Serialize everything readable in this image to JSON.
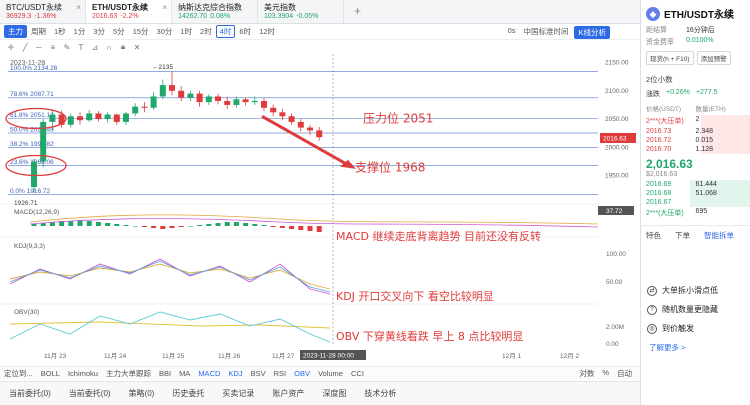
{
  "tabs": [
    {
      "name": "BTC/USDT永续",
      "price": "36929.3",
      "change": "-1.36%",
      "dir": "down"
    },
    {
      "name": "ETH/USDT永续",
      "price": "2016.63",
      "change": "-2.2%",
      "dir": "down",
      "active": true
    },
    {
      "name": "纳斯达克综合指数",
      "price": "14262.70",
      "change": "0.08%",
      "dir": "up"
    },
    {
      "name": "美元指数",
      "price": "103.3904",
      "change": "-0.05%",
      "dir": "up"
    }
  ],
  "toolbar": {
    "items": [
      "主力",
      "周期",
      "1秒",
      "1分",
      "3分",
      "5分",
      "15分",
      "30分",
      "1时",
      "2时",
      "4时",
      "6时",
      "12时"
    ],
    "active": "4时",
    "right": [
      "0s",
      "中国标准时间",
      "K线分析"
    ]
  },
  "chart": {
    "date_label": "2023-11-28",
    "fib_levels": [
      {
        "label": "100.0% 2134.26",
        "value": 2134.26
      },
      {
        "label": "78.6% 2087.71",
        "value": 2087.71
      },
      {
        "label": "61.8% 2051.13",
        "value": 2051.13
      },
      {
        "label": "50.0% 2025.49",
        "value": 2025.49
      },
      {
        "label": "38.2% 1999.82",
        "value": 1999.82
      },
      {
        "label": "23.6% 1968.06",
        "value": 1968.06
      },
      {
        "label": "0.0% 1916.72",
        "value": 1916.72
      }
    ],
    "price_axis": [
      "2150.00",
      "2100.00",
      "2050.00",
      "2000.00",
      "1950.00"
    ],
    "current_price": "2016.63",
    "high_label": "2135",
    "low_label": "1926.71",
    "macd_label": "MACD(12,26,9)",
    "macd_value": "37.72",
    "kdj_label": "KDJ(9,3,3)",
    "kdj_axis": [
      "100.00",
      "50.00"
    ],
    "obv_label": "OBV(30)",
    "obv_axis": [
      "2.00M",
      "0.00"
    ],
    "x_labels": [
      "11月 23",
      "11月 24",
      "11月 25",
      "11月 26",
      "11月 27",
      "12月 1",
      "12月 2"
    ],
    "cursor_time": "2023-11-28 00:00",
    "annotations": {
      "resistance": "压力位 2051",
      "support": "支撑位 1968",
      "macd": "MACD 继续走底背离趋势 目前还没有反转",
      "kdj": "KDJ 开口交叉向下 看空比较明显",
      "obv": "OBV 下穿黄线看跌 早上 8 点比较明显"
    }
  },
  "chart_data": {
    "type": "line",
    "title": "",
    "xlabel": "",
    "ylabel": "",
    "ylim": [
      1916,
      2160
    ],
    "x": [
      "11月 23",
      "11月 24",
      "11月 25",
      "11月 26",
      "11月 27",
      "2023-11-28"
    ],
    "series": [
      {
        "values": [
          1960,
          2060,
          2065,
          2125,
          2090,
          2075,
          2015
        ]
      }
    ]
  },
  "indicators": {
    "items": [
      "定位到...",
      "BOLL",
      "Ichimoku",
      "主力大单跟踪",
      "BBI",
      "MA",
      "MACD",
      "KDJ",
      "BSV",
      "RSI",
      "OBV",
      "Volume",
      "CCI"
    ],
    "active": [
      "MACD",
      "KDJ",
      "OBV"
    ],
    "right": [
      "对数",
      "%",
      "自动"
    ]
  },
  "order_tabs": [
    "当前委托(0)",
    "当前委托(0)",
    "策略(0)",
    "历史委托",
    "买卖记录",
    "账户资产",
    "深度图",
    "技术分析"
  ],
  "panel": {
    "title": "ETH/USDT永续",
    "kv": [
      {
        "k": "距结算",
        "v": "16分钟后",
        "k2": "价格指数",
        "v2": "2"
      },
      {
        "k": "资金费率",
        "v": "0.0100%",
        "k2": "标记价格",
        "v2": "2"
      }
    ],
    "buttons": [
      "现货(h + F10)",
      "添加预警",
      "止盈"
    ],
    "section": "2位小数",
    "ticker": [
      {
        "k": "涨跌",
        "v": "+0.26%",
        "v2": "+277.5"
      }
    ],
    "head": [
      "价格(USDT)",
      "数量(ETH)",
      "累"
    ],
    "asks": [
      {
        "p": "2***(大压单)",
        "q": "2",
        "t": ""
      },
      {
        "p": "2016.73",
        "q": "2.348",
        "t": "7"
      },
      {
        "p": "2016.72",
        "q": "0.015",
        "t": "7"
      },
      {
        "p": "2016.70",
        "q": "1.128",
        "t": "7"
      }
    ],
    "mid_price": "2,016.63",
    "mid_sub": "$2,016.63",
    "bids": [
      {
        "p": "2016.69",
        "q": "61.444",
        "t": "7"
      },
      {
        "p": "2016.68",
        "q": "51.068",
        "t": "7"
      },
      {
        "p": "2016.67",
        "q": "",
        "t": ""
      },
      {
        "p": "2***(大压单)",
        "q": "695",
        "t": ""
      }
    ],
    "tabs": [
      "特色",
      "下单",
      "智能拆单"
    ],
    "features": [
      "大单拆小滑点低",
      "随机数量更隐藏",
      "到价触发"
    ],
    "more": "了解更多 >"
  },
  "colors": {
    "up": "#20a86b",
    "down": "#e03b3b",
    "accent": "#2e6be6",
    "annotation": "#e03b3b"
  }
}
